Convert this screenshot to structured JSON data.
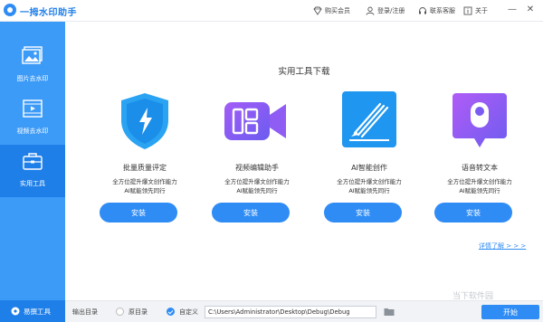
{
  "app": {
    "title": "一拇水印助手"
  },
  "titlebar": {
    "vip_label": "购买会员",
    "login_label": "登录/注册",
    "service_label": "联系客服",
    "about_label": "关于",
    "minimize_label": "—",
    "close_label": "✕"
  },
  "sidebar": {
    "items": [
      {
        "label": "图片去水印",
        "icon": "image-icon"
      },
      {
        "label": "视频去水印",
        "icon": "video-icon"
      },
      {
        "label": "实用工具",
        "icon": "toolbox-icon",
        "active": true
      }
    ],
    "brand": "易撰工具"
  },
  "main": {
    "title": "实用工具下载",
    "cards": [
      {
        "name": "批量质量评定",
        "desc1": "全方位提升爆文创作能力",
        "desc2": "AI赋能领先同行",
        "button": "安装",
        "icon": "shield-bolt-icon",
        "color": "#1f9cf0"
      },
      {
        "name": "视频编辑助手",
        "desc1": "全方位提升爆文创作能力",
        "desc2": "AI赋能领先同行",
        "button": "安装",
        "icon": "video-editor-icon",
        "color": "#8b5cf6"
      },
      {
        "name": "AI智能创作",
        "desc1": "全方位提升爆文创作能力",
        "desc2": "AI赋能领先同行",
        "button": "安装",
        "icon": "ai-pen-icon",
        "color": "#1f9cf0"
      },
      {
        "name": "语音转文本",
        "desc1": "全方位提升爆文创作能力",
        "desc2": "AI赋能领先同行",
        "button": "安装",
        "icon": "voice-icon",
        "color": "#8b5cf6"
      }
    ],
    "more_link": "详情了解 > > >"
  },
  "bottombar": {
    "output_label": "输出目录",
    "original_dir_label": "原目录",
    "custom_label": "自定义",
    "path_value": "C:\\Users\\Administrator\\Desktop\\Debug\\Debug",
    "start_label": "开始"
  },
  "watermark": "当下软件园"
}
